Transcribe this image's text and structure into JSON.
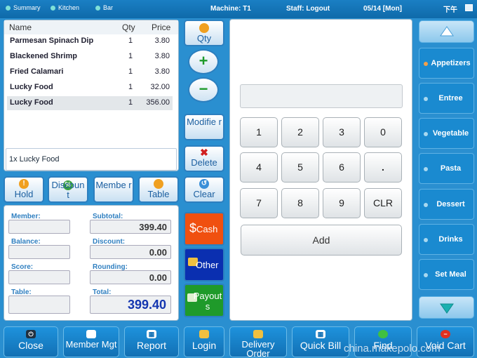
{
  "topbar": {
    "tabs": [
      "Summary",
      "Kitchen",
      "Bar"
    ],
    "machine": "Machine: T1",
    "staff": "Staff: Logout",
    "date": "05/14 [Mon]",
    "ampm": "下午"
  },
  "order": {
    "headers": {
      "name": "Name",
      "qty": "Qty",
      "price": "Price"
    },
    "items": [
      {
        "name": "Parmesan Spinach Dip",
        "qty": "1",
        "price": "3.80"
      },
      {
        "name": "Blackened Shrimp",
        "qty": "1",
        "price": "3.80"
      },
      {
        "name": "Fried Calamari",
        "qty": "1",
        "price": "3.80"
      },
      {
        "name": "Lucky Food",
        "qty": "1",
        "price": "32.00"
      },
      {
        "name": "Lucky Food",
        "qty": "1",
        "price": "356.00"
      }
    ],
    "detail": "1x Lucky Food"
  },
  "actions": {
    "hold": "Hold",
    "discount": "Discoun t",
    "member": "Membe r",
    "table": "Table"
  },
  "summary": {
    "member_label": "Member:",
    "subtotal_label": "Subtotal:",
    "subtotal": "399.40",
    "balance_label": "Balance:",
    "discount_label": "Discount:",
    "discount": "0.00",
    "score_label": "Score:",
    "rounding_label": "Rounding:",
    "rounding": "0.00",
    "table_label": "Table:",
    "total_label": "Total:",
    "total": "399.40"
  },
  "middle": {
    "qty": "Qty",
    "plus": "+",
    "minus": "−",
    "modifier": "Modifie r",
    "delete": "Delete",
    "clear": "Clear",
    "cash": "Cash",
    "other": "Other",
    "payouts": "Payout s"
  },
  "keypad": {
    "keys": [
      "1",
      "2",
      "3",
      "0",
      "4",
      "5",
      "6",
      ".",
      "7",
      "8",
      "9",
      "CLR"
    ],
    "add": "Add"
  },
  "categories": [
    {
      "label": "Appetizers",
      "active": true
    },
    {
      "label": "Entree",
      "active": false
    },
    {
      "label": "Vegetable",
      "active": false
    },
    {
      "label": "Pasta",
      "active": false
    },
    {
      "label": "Dessert",
      "active": false
    },
    {
      "label": "Drinks",
      "active": false
    },
    {
      "label": "Set Meal",
      "active": false
    }
  ],
  "bottom": {
    "close": "Close",
    "member_mgt": "Member Mgt",
    "report": "Report",
    "login": "Login",
    "delivery": "Delivery Order",
    "quick_bill": "Quick Bill",
    "find": "Find",
    "void": "Void Cart"
  },
  "watermark": "china.makepolo.com",
  "colors": {
    "accent": "#2c7fbf",
    "cash": "#f05010",
    "other": "#0a2fb0",
    "payouts": "#1f9a2a",
    "total": "#1436b0"
  }
}
